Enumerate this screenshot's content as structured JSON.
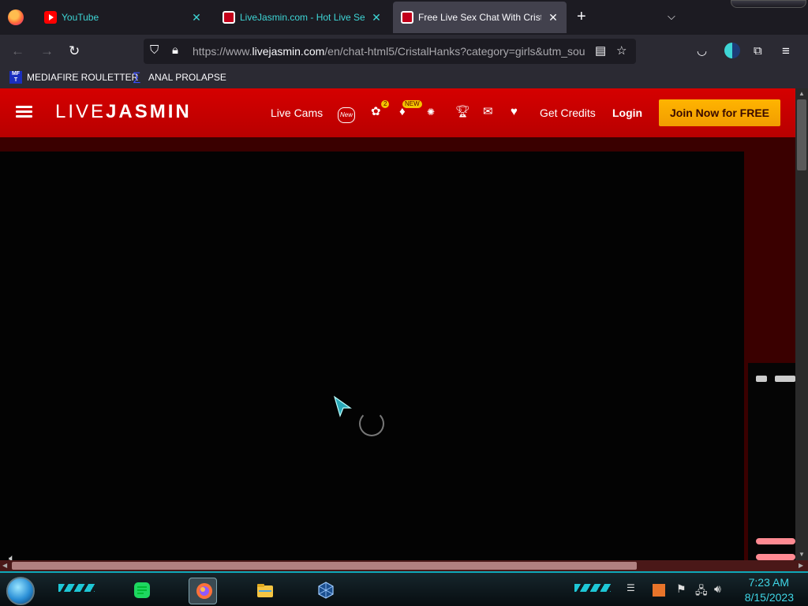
{
  "browser": {
    "tabs": [
      {
        "title": "YouTube",
        "favicon": "youtube-icon"
      },
      {
        "title": "LiveJasmin.com - Hot Live Sex",
        "favicon": "livejasmin-icon"
      },
      {
        "title": "Free Live Sex Chat With CristalH",
        "favicon": "livejasmin-icon"
      }
    ],
    "new_tab": "+",
    "list_tabs": "⌵",
    "url_prefix": "https://www.",
    "url_domain": "livejasmin.com",
    "url_suffix": "/en/chat-html5/CristalHanks?category=girls&utm_sou",
    "bookmarks": [
      {
        "label": "MEDIAFIRE ROULETTER",
        "icon_text": "MF T"
      },
      {
        "label": "ANAL PROLAPSE",
        "icon_text": "∑"
      }
    ]
  },
  "site": {
    "logo_light": "LIVE",
    "logo_bold": "JASMIN",
    "nav_live_cams": "Live Cams",
    "new_icon_text": "New",
    "badge_count": "2",
    "badge_new": "NEW",
    "get_credits": "Get Credits",
    "login": "Login",
    "join": "Join Now for FREE"
  },
  "taskbar": {
    "time": "7:23 AM",
    "date": "8/15/2023"
  },
  "colors": {
    "header_red": "#d50000",
    "join_orange": "#ffb400",
    "taskbar_cyan": "#3fd6e6"
  }
}
